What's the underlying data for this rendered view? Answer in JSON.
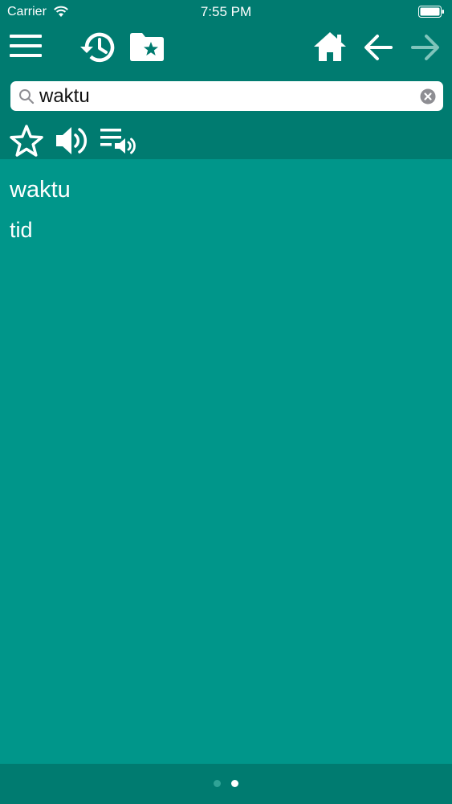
{
  "status_bar": {
    "carrier": "Carrier",
    "time": "7:55 PM"
  },
  "toolbar": {
    "icons": [
      "menu-icon",
      "history-icon",
      "favorites-folder-icon",
      "home-icon",
      "back-arrow-icon",
      "forward-arrow-icon"
    ],
    "forward_enabled": false
  },
  "search": {
    "value": "waktu",
    "placeholder": ""
  },
  "actions": {
    "icons": [
      "star-icon",
      "speaker-icon",
      "playlist-audio-icon"
    ]
  },
  "entry": {
    "headword": "waktu",
    "translation": "tid"
  },
  "pagination": {
    "pages": 2,
    "current_page": 2
  },
  "colors": {
    "header": "#007b70",
    "content_background": "#00968a",
    "text": "#ffffff",
    "disabled_icon": "#7fc4bb"
  }
}
